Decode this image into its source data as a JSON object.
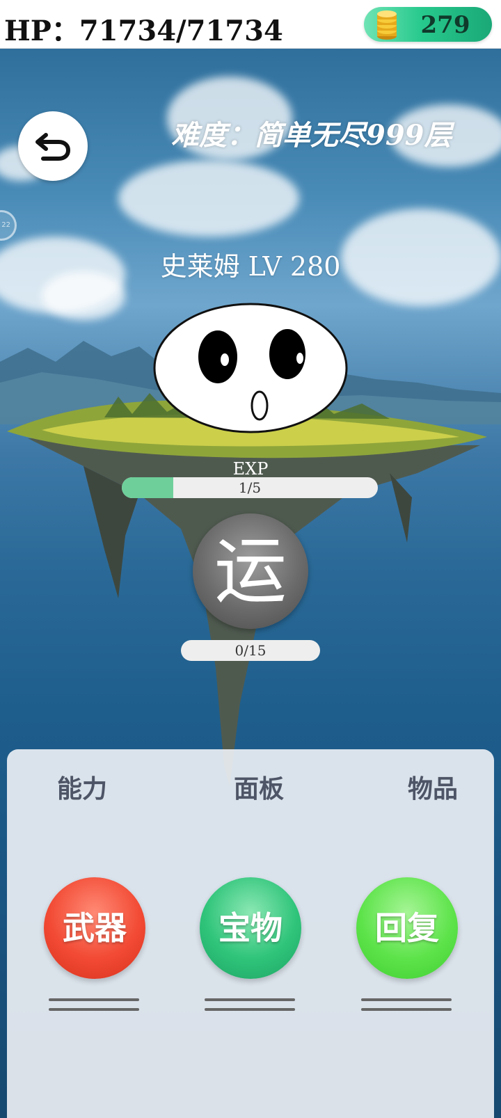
{
  "status": {
    "hp_label": "HP：",
    "hp_current": "71734",
    "hp_max": "71734",
    "hp_text": "HP：71734/71734",
    "coins": "279"
  },
  "difficulty": "难度：简单无尽999层",
  "monster": {
    "name": "史莱姆",
    "level": "LV 280",
    "name_line": "史莱姆 LV 280"
  },
  "exp": {
    "label": "EXP",
    "text": "1/5",
    "fraction": 0.2
  },
  "luck": {
    "char": "运",
    "text": "0/15",
    "fraction": 0
  },
  "tabs": [
    {
      "label": "能力"
    },
    {
      "label": "面板"
    },
    {
      "label": "物品"
    }
  ],
  "actions": [
    {
      "label": "武器",
      "color": "#f24a34"
    },
    {
      "label": "宝物",
      "color": "#2fc47a"
    },
    {
      "label": "回复",
      "color": "#5ee34b"
    }
  ],
  "colors": {
    "coin_pill": "#27c98d",
    "progress_fill": "#6ecf9a"
  },
  "icons": {
    "back": "back-arrow-icon",
    "coin": "coin-stack-icon"
  }
}
